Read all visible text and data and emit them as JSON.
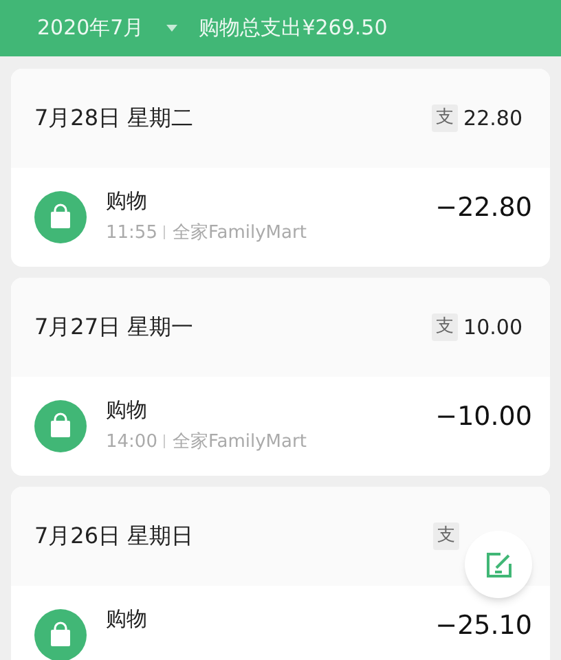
{
  "header": {
    "month": "2020年7月",
    "summary": "购物总支出¥269.50"
  },
  "days": [
    {
      "date": "7月28日 星期二",
      "total_label": "支",
      "total": "22.80",
      "entries": [
        {
          "category": "购物",
          "time": "11:55",
          "merchant": "全家FamilyMart",
          "amount": "−22.80"
        }
      ]
    },
    {
      "date": "7月27日 星期一",
      "total_label": "支",
      "total": "10.00",
      "entries": [
        {
          "category": "购物",
          "time": "14:00",
          "merchant": "全家FamilyMart",
          "amount": "−10.00"
        }
      ]
    },
    {
      "date": "7月26日 星期日",
      "total_label": "支",
      "entries": [
        {
          "category": "购物",
          "amount": "−25.10"
        }
      ]
    }
  ]
}
